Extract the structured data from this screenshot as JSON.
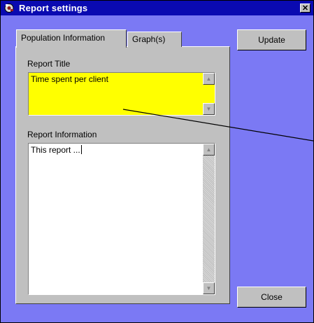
{
  "window": {
    "title": "Report settings",
    "close_label": "✕",
    "title_icon": "report-gear-icon"
  },
  "tabs": [
    {
      "label": "Population Information",
      "active": true
    },
    {
      "label": "Graph(s)",
      "active": false
    }
  ],
  "report_title": {
    "label": "Report Title",
    "value": "Time spent per client",
    "background": "#ffff00"
  },
  "report_information": {
    "label": "Report Information",
    "value": "This report ..."
  },
  "buttons": {
    "update_label": "Update",
    "close_label": "Close"
  },
  "colors": {
    "titlebar": "#0a0ab1",
    "client_area": "#7b79f4",
    "panel": "#c0c0c0"
  }
}
